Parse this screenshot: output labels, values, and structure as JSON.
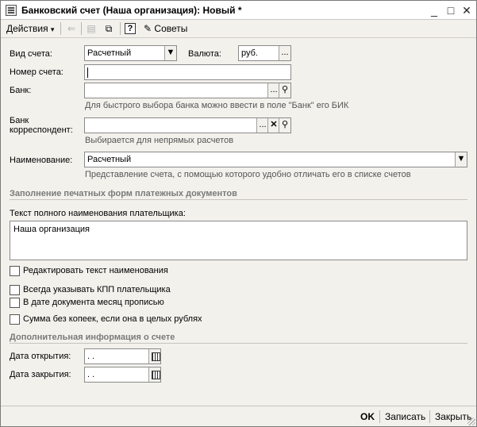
{
  "window": {
    "title": "Банковский счет (Наша организация): Новый *"
  },
  "title_buttons": {
    "minimize": "_",
    "maximize": "□",
    "close": "✕"
  },
  "toolbar": {
    "actions_label": "Действия",
    "actions_caret": "▾",
    "help_label": "?",
    "tips_label": "Советы"
  },
  "form": {
    "account_type_label": "Вид счета:",
    "account_type_value": "Расчетный",
    "currency_label": "Валюта:",
    "currency_value": "руб.",
    "account_number_label": "Номер счета:",
    "account_number_value": "",
    "bank_label": "Банк:",
    "bank_value": "",
    "bank_hint": "Для быстрого выбора банка можно ввести в поле \"Банк\" его БИК",
    "corr_bank_label_1": "Банк",
    "corr_bank_label_2": "корреспондент:",
    "corr_bank_value": "",
    "corr_bank_hint": "Выбирается для непрямых расчетов",
    "name_label": "Наименование:",
    "name_value": "Расчетный",
    "name_hint": "Представление счета, с помощью которого удобно отличать его в списке счетов"
  },
  "section_print": {
    "title": "Заполнение печатных форм платежных документов",
    "payer_full_name_label": "Текст полного наименования плательщика:",
    "payer_full_name_value": "Наша организация",
    "checkboxes": [
      {
        "label": "Редактировать текст наименования",
        "checked": false
      },
      {
        "label": "Всегда указывать КПП плательщика",
        "checked": false
      },
      {
        "label": "В дате документа месяц прописью",
        "checked": false
      },
      {
        "label": "Сумма без копеек, если она в целых рублях",
        "checked": false
      }
    ]
  },
  "section_extra": {
    "title": "Дополнительная информация о счете",
    "open_date_label": "Дата открытия:",
    "open_date_value": " .  .",
    "close_date_label": "Дата закрытия:",
    "close_date_value": " .  ."
  },
  "buttons": {
    "ok": "OK",
    "save": "Записать",
    "close": "Закрыть"
  },
  "field_buttons": {
    "ellipsis": "...",
    "dropdown": "▼",
    "clear": "✕",
    "search": "🔍"
  },
  "icons": {
    "app": "form-icon",
    "back": "arrow-left-icon",
    "filter": "filter-icon",
    "refresh": "copy-icon",
    "help": "help-icon",
    "tips": "book-icon",
    "calendar": "calendar-icon"
  }
}
